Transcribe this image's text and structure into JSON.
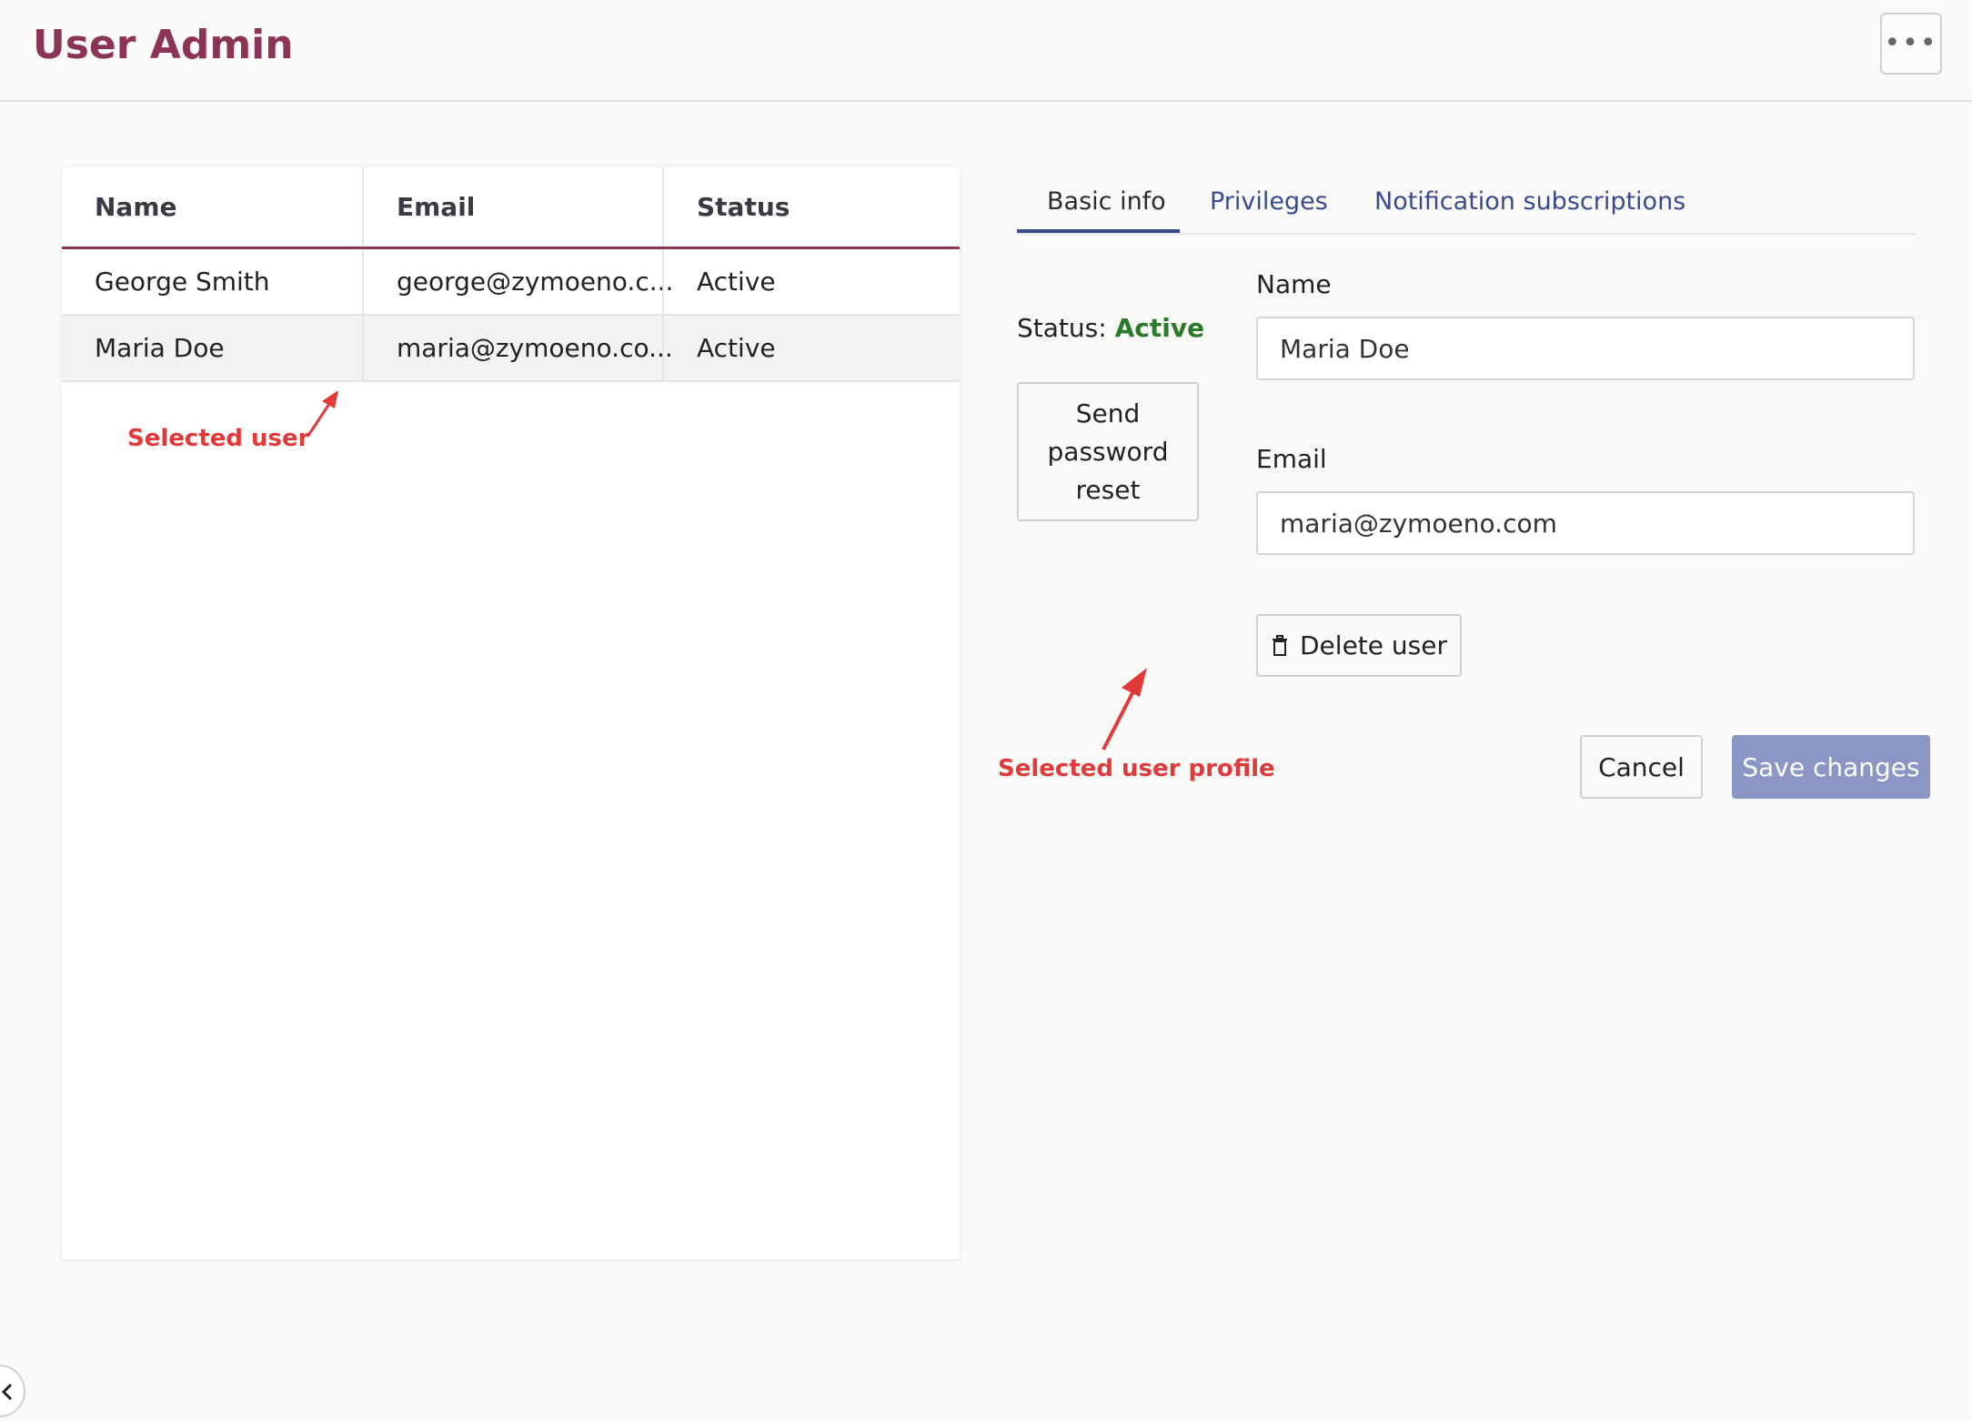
{
  "header": {
    "title": "User Admin",
    "more_icon": "more-horizontal-icon",
    "more_label": "•••"
  },
  "table": {
    "columns": [
      "Name",
      "Email",
      "Status"
    ],
    "rows": [
      {
        "name": "George Smith",
        "email": "george@zymoeno.c...",
        "status": "Active"
      },
      {
        "name": "Maria Doe",
        "email": "maria@zymoeno.co...",
        "status": "Active"
      }
    ],
    "selected_index": 1
  },
  "annotations": {
    "selected_user": "Selected user",
    "selected_user_profile": "Selected user profile",
    "color": "#e23a3a"
  },
  "tabs": [
    {
      "label": "Basic info",
      "active": true
    },
    {
      "label": "Privileges",
      "active": false
    },
    {
      "label": "Notification subscriptions",
      "active": false
    }
  ],
  "profile": {
    "status_label": "Status:",
    "status_value": "Active",
    "reset_button": "Send password reset",
    "name_label": "Name",
    "name_value": "Maria Doe",
    "email_label": "Email",
    "email_value": "maria@zymoeno.com",
    "delete_icon": "trash-icon",
    "delete_label": "Delete user"
  },
  "actions": {
    "cancel": "Cancel",
    "save": "Save changes"
  },
  "colors": {
    "brand": "#8c3457",
    "tab_accent": "#3a4a8c",
    "status_active": "#2a7a2a",
    "save_disabled": "#8b96c4"
  }
}
